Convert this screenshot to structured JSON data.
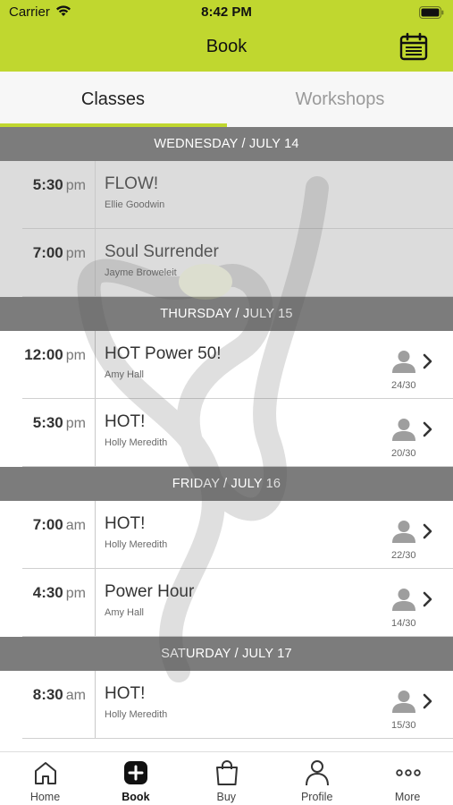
{
  "status_bar": {
    "carrier": "Carrier",
    "time": "8:42 PM"
  },
  "nav": {
    "title": "Book",
    "calendar_icon": "calendar-icon"
  },
  "tabs": [
    {
      "label": "Classes",
      "selected": true
    },
    {
      "label": "Workshops",
      "selected": false
    }
  ],
  "colors": {
    "accent": "#c0d72f",
    "day_header": "#7c7c7c",
    "past_row": "#dcdcdc"
  },
  "days": [
    {
      "header": "WEDNESDAY / JULY 14",
      "classes": [
        {
          "time": "5:30",
          "ampm": "pm",
          "name": "FLOW!",
          "instructor": "Ellie Goodwin",
          "capacity": "",
          "past": true
        },
        {
          "time": "7:00",
          "ampm": "pm",
          "name": "Soul Surrender",
          "instructor": "Jayme Broweleit",
          "capacity": "",
          "past": true
        }
      ]
    },
    {
      "header": "THURSDAY / JULY 15",
      "classes": [
        {
          "time": "12:00",
          "ampm": "pm",
          "name": "HOT Power 50!",
          "instructor": "Amy Hall",
          "capacity": "24/30",
          "past": false
        },
        {
          "time": "5:30",
          "ampm": "pm",
          "name": "HOT!",
          "instructor": "Holly Meredith",
          "capacity": "20/30",
          "past": false
        }
      ]
    },
    {
      "header": "FRIDAY / JULY 16",
      "classes": [
        {
          "time": "7:00",
          "ampm": "am",
          "name": "HOT!",
          "instructor": "Holly Meredith",
          "capacity": "22/30",
          "past": false
        },
        {
          "time": "4:30",
          "ampm": "pm",
          "name": "Power Hour",
          "instructor": "Amy Hall",
          "capacity": "14/30",
          "past": false
        }
      ]
    },
    {
      "header": "SATURDAY / JULY 17",
      "classes": [
        {
          "time": "8:30",
          "ampm": "am",
          "name": "HOT!",
          "instructor": "Holly Meredith",
          "capacity": "15/30",
          "past": false
        }
      ]
    }
  ],
  "tab_bar": [
    {
      "label": "Home",
      "icon": "home-icon",
      "active": false
    },
    {
      "label": "Book",
      "icon": "plus-square-icon",
      "active": true
    },
    {
      "label": "Buy",
      "icon": "shopping-bag-icon",
      "active": false
    },
    {
      "label": "Profile",
      "icon": "person-icon",
      "active": false
    },
    {
      "label": "More",
      "icon": "more-dots-icon",
      "active": false
    }
  ]
}
